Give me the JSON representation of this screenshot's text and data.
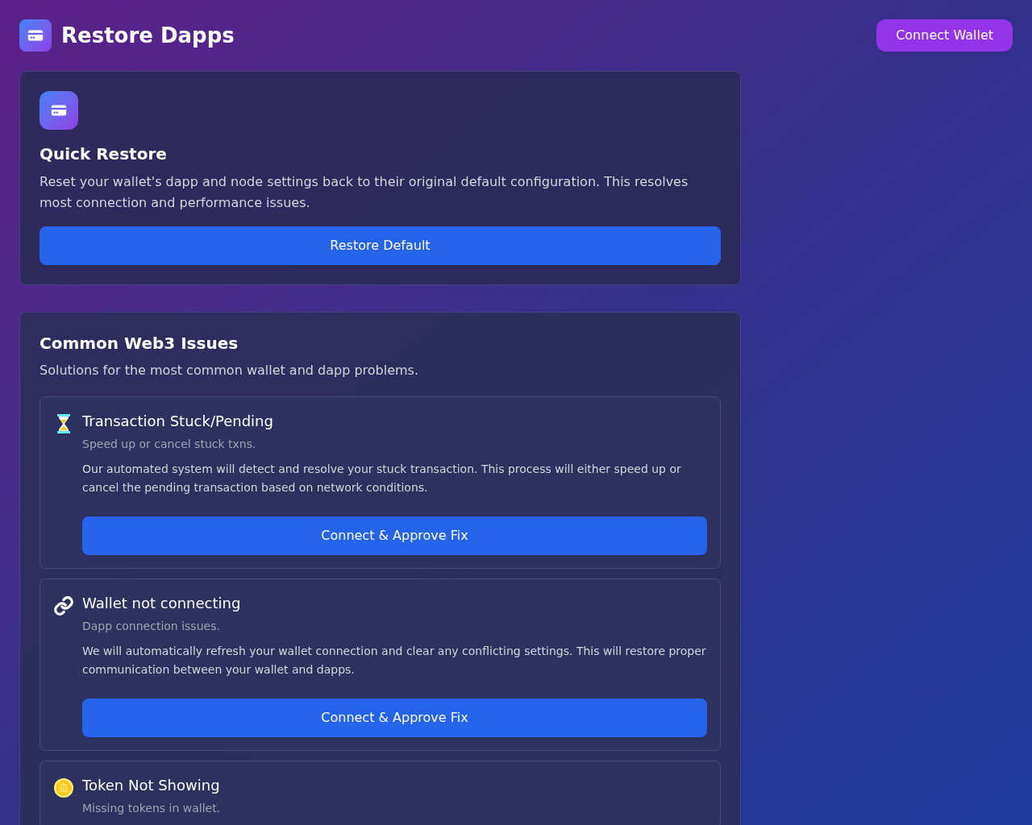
{
  "header": {
    "title": "Restore Dapps",
    "connect_button": "Connect Wallet"
  },
  "quick_restore": {
    "title": "Quick Restore",
    "description": "Reset your wallet's dapp and node settings back to their original default configuration. This resolves most connection and performance issues.",
    "button": "Restore Default"
  },
  "issues": {
    "title": "Common Web3 Issues",
    "subtitle": "Solutions for the most common wallet and dapp problems.",
    "items": [
      {
        "kind": "hourglass",
        "title": "Transaction Stuck/Pending",
        "subtitle": "Speed up or cancel stuck txns.",
        "description": "Our automated system will detect and resolve your stuck transaction. This process will either speed up or cancel the pending transaction based on network conditions.",
        "button": "Connect & Approve Fix"
      },
      {
        "kind": "link",
        "title": "Wallet not connecting",
        "subtitle": "Dapp connection issues.",
        "description": "We will automatically refresh your wallet connection and clear any conflicting settings. This will restore proper communication between your wallet and dapps.",
        "button": "Connect & Approve Fix"
      },
      {
        "kind": "coin",
        "title": "Token Not Showing",
        "subtitle": "Missing tokens in wallet."
      }
    ]
  }
}
